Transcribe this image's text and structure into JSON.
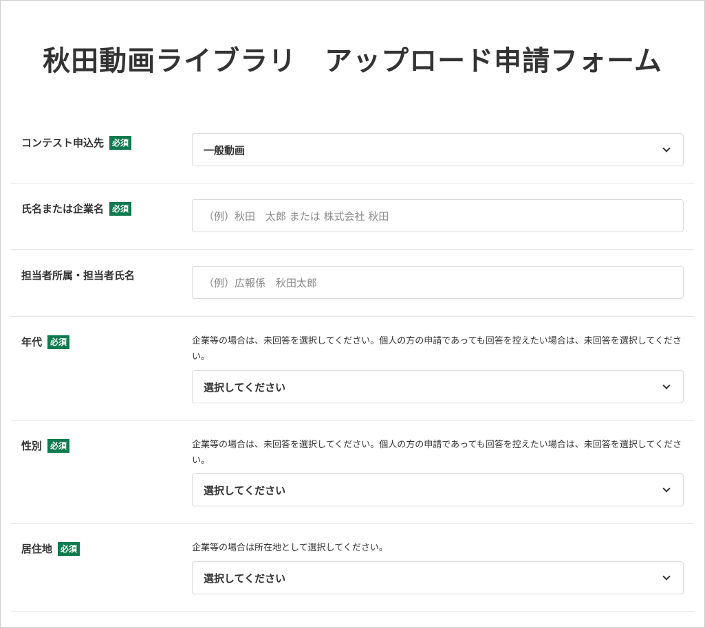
{
  "form": {
    "title": "秋田動画ライブラリ　アップロード申請フォーム",
    "required_badge": "必須"
  },
  "fields": {
    "contest": {
      "label": "コンテスト申込先",
      "required": true,
      "type": "select",
      "selected": "一般動画"
    },
    "name": {
      "label": "氏名または企業名",
      "required": true,
      "type": "text",
      "value": "",
      "placeholder": "（例）秋田　太郎 または 株式会社 秋田"
    },
    "contact": {
      "label": "担当者所属・担当者氏名",
      "required": false,
      "type": "text",
      "value": "",
      "placeholder": "（例）広報係　秋田太郎"
    },
    "age": {
      "label": "年代",
      "required": true,
      "type": "select",
      "note": "企業等の場合は、未回答を選択してください。個人の方の申請であっても回答を控えたい場合は、未回答を選択してください。",
      "selected": "選択してください"
    },
    "gender": {
      "label": "性別",
      "required": true,
      "type": "select",
      "note": "企業等の場合は、未回答を選択してください。個人の方の申請であっても回答を控えたい場合は、未回答を選択してください。",
      "selected": "選択してください"
    },
    "residence": {
      "label": "居住地",
      "required": true,
      "type": "select",
      "note": "企業等の場合は所在地として選択してください。",
      "selected": "選択してください"
    }
  },
  "icons": {
    "select_arrow": "chevron-down-icon"
  },
  "colors": {
    "required_badge_bg": "#0f7a4f",
    "text": "#333333",
    "placeholder": "#8a8a8a",
    "border": "#d9d9d9"
  }
}
